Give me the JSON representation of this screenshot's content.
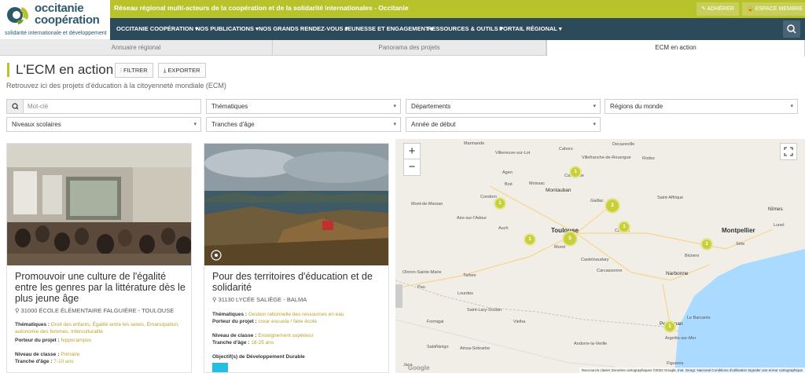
{
  "logo": {
    "line1": "occitanie",
    "line2": "coopération",
    "sub": "solidarité internationale et développement"
  },
  "topbar": {
    "text": "Réseau régional multi-acteurs de la coopération et de la solidarité internationales - Occitanie",
    "adherer": "ADHÉRER",
    "espace": "ESPACE MEMBRE"
  },
  "nav": [
    {
      "label": "OCCITANIE COOPÉRATION"
    },
    {
      "label": "NOS PUBLICATIONS"
    },
    {
      "label": "NOS GRANDS RENDEZ-VOUS"
    },
    {
      "label": "JEUNESSE ET ENGAGEMENT"
    },
    {
      "label": "RESSOURCES & OUTILS"
    },
    {
      "label": "PORTAIL RÉGIONAL"
    }
  ],
  "tabs": [
    {
      "label": "Annuaire régional"
    },
    {
      "label": "Panorama des projets"
    },
    {
      "label": "ECM en action"
    }
  ],
  "page": {
    "title": "L'ECM en action",
    "filter_label": "FILTRER",
    "export_label": "EXPORTER",
    "subtitle": "Retrouvez ici des projets d'éducation à la citoyenneté mondiale (ECM)"
  },
  "filters": {
    "keyword_placeholder": "Mot-clé",
    "thematiques": "Thématiques",
    "departements": "Départements",
    "regions": "Régions du monde",
    "niveaux": "Niveaux scolaires",
    "tranches": "Tranches d'âge",
    "annee": "Année de début"
  },
  "cards": [
    {
      "title": "Promouvoir une culture de l'égalité entre les genres par la littérature dès le plus jeune âge",
      "location": "31000 ÉCOLE ÉLÉMENTAIRE FALGUIÈRE - TOULOUSE",
      "thematiques_label": "Thématiques :",
      "thematiques": "Droit des enfants, Égalité entre les sexes, Émancipation, autonomie des femmes, Interculturalité",
      "porteur_label": "Porteur du projet :",
      "porteur": "hippocampes",
      "niveau_label": "Niveau de classe :",
      "niveau": "Primaire",
      "tranche_label": "Tranche d'âge :",
      "tranche": "7-10 ans"
    },
    {
      "title": "Pour des territoires d'éducation et de solidarité",
      "location": "31130 LYCÉE SALIÈGE - BALMA",
      "thematiques_label": "Thématiques :",
      "thematiques": "Gestion rationnelle des ressources en eau",
      "porteur_label": "Porteur du projet :",
      "porteur": "crear escuela / faire école",
      "niveau_label": "Niveau de classe :",
      "niveau": "Enseignement supérieur",
      "tranche_label": "Tranche d'âge :",
      "tranche": "18-25 ans",
      "odd_label": "Objectif(s) de Développement Durable"
    }
  ],
  "map": {
    "zoom_in": "+",
    "zoom_out": "−",
    "google": "Google",
    "credits": "Raccourcis clavier    Données cartographiques ©2022 Google, Inst. Geogr. Nacional    Conditions d'utilisation    Signaler une erreur cartographique",
    "labels": [
      {
        "text": "Marmande"
      },
      {
        "text": "Villeneuve-sur-Lot"
      },
      {
        "text": "Cahors"
      },
      {
        "text": "Decazeville"
      },
      {
        "text": "Villefranche-de-Rouergue"
      },
      {
        "text": "Rodez"
      },
      {
        "text": "Agen"
      },
      {
        "text": "Caussade"
      },
      {
        "text": "Boé"
      },
      {
        "text": "Moissac"
      },
      {
        "text": "Montauban"
      },
      {
        "text": "Condom"
      },
      {
        "text": "Gaillac"
      },
      {
        "text": "Saint-Affrique"
      },
      {
        "text": "Mont-de-Marsan"
      },
      {
        "text": "Auch"
      },
      {
        "text": "Toulouse"
      },
      {
        "text": "Castres"
      },
      {
        "text": "Montpellier"
      },
      {
        "text": "Nîmes"
      },
      {
        "text": "Lunel"
      },
      {
        "text": "Sète"
      },
      {
        "text": "Muret"
      },
      {
        "text": "Béziers"
      },
      {
        "text": "Castelnaudary"
      },
      {
        "text": "Carcassonne"
      },
      {
        "text": "Narbonne"
      },
      {
        "text": "Tarbes"
      },
      {
        "text": "Lourdes"
      },
      {
        "text": "Saint-Lary-Soulan"
      },
      {
        "text": "Perpignan"
      },
      {
        "text": "Argelès-sur-Mer"
      },
      {
        "text": "Le Barcarès"
      },
      {
        "text": "Vielha"
      },
      {
        "text": "Formigal"
      },
      {
        "text": "Sabiñánigo"
      },
      {
        "text": "Ainsa-Sobrarbe"
      },
      {
        "text": "Andorre-la-Vieille"
      },
      {
        "text": "Figueres"
      },
      {
        "text": "Pau"
      },
      {
        "text": "Oloron-Sainte-Marie"
      },
      {
        "text": "Aire-sur-l'Adour"
      },
      {
        "text": "Jaca"
      }
    ],
    "markers": [
      {
        "count": "1"
      },
      {
        "count": "1"
      },
      {
        "count": "2"
      },
      {
        "count": "1"
      },
      {
        "count": "1"
      },
      {
        "count": "5"
      },
      {
        "count": "1"
      },
      {
        "count": "1"
      }
    ]
  }
}
